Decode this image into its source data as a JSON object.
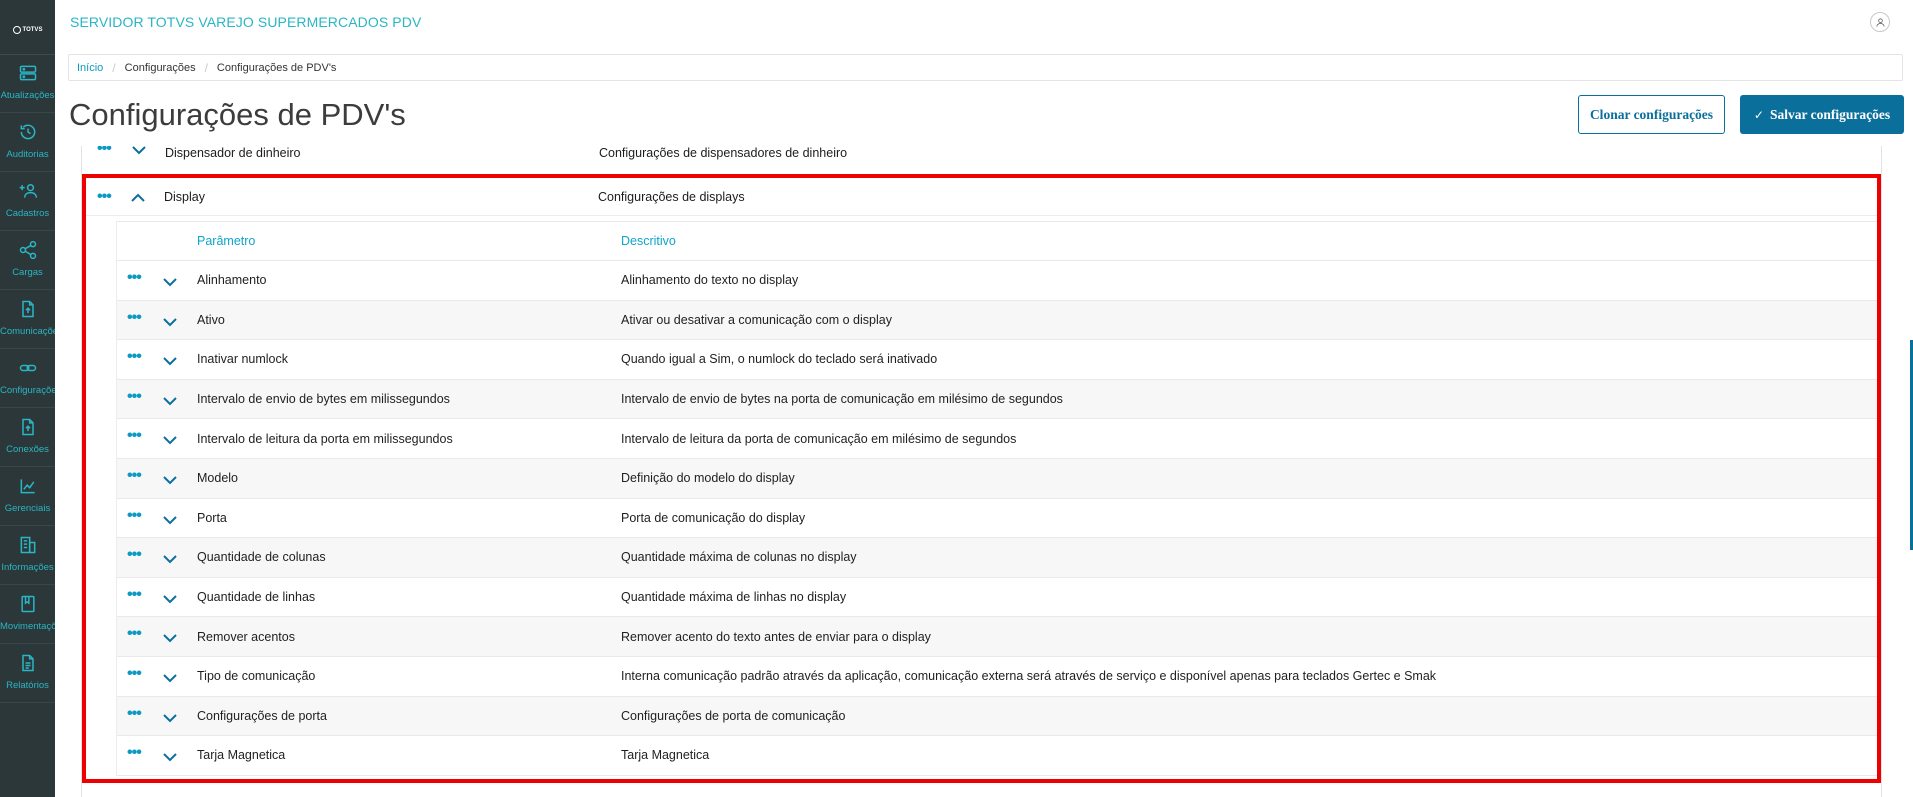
{
  "app": {
    "title": "SERVIDOR TOTVS VAREJO SUPERMERCADOS PDV",
    "logo_text": "TOTVS"
  },
  "sidebar": {
    "items": [
      {
        "label": "Atualizações",
        "icon": "server-icon"
      },
      {
        "label": "Auditorias",
        "icon": "history-icon"
      },
      {
        "label": "Cadastros",
        "icon": "add-user-icon"
      },
      {
        "label": "Cargas",
        "icon": "share-icon"
      },
      {
        "label": "Comunicações",
        "icon": "upload-file-icon"
      },
      {
        "label": "Configurações",
        "icon": "link-icon"
      },
      {
        "label": "Conexões",
        "icon": "upload-file-icon"
      },
      {
        "label": "Gerenciais",
        "icon": "chart-icon"
      },
      {
        "label": "Informações",
        "icon": "building-icon"
      },
      {
        "label": "Movimentações",
        "icon": "book-icon"
      },
      {
        "label": "Relatórios",
        "icon": "document-icon"
      }
    ]
  },
  "breadcrumb": [
    "Início",
    "Configurações",
    "Configurações de PDV's"
  ],
  "page": {
    "title": "Configurações de PDV's",
    "clone_button": "Clonar configurações",
    "save_button": "Salvar configurações"
  },
  "groups": {
    "previous": {
      "name": "Dispensador de dinheiro",
      "description": "Configurações de dispensadores de dinheiro"
    },
    "current": {
      "name": "Display",
      "description": "Configurações de displays"
    }
  },
  "table": {
    "headers": {
      "parameter": "Parâmetro",
      "description": "Descritivo"
    },
    "rows": [
      {
        "parameter": "Alinhamento",
        "description": "Alinhamento do texto no display"
      },
      {
        "parameter": "Ativo",
        "description": "Ativar ou desativar a comunicação com o display"
      },
      {
        "parameter": "Inativar numlock",
        "description": "Quando igual a Sim, o numlock do teclado será inativado"
      },
      {
        "parameter": "Intervalo de envio de bytes em milissegundos",
        "description": "Intervalo de envio de bytes na porta de comunicação em milésimo de segundos"
      },
      {
        "parameter": "Intervalo de leitura da porta em milissegundos",
        "description": "Intervalo de leitura da porta de comunicação em milésimo de segundos"
      },
      {
        "parameter": "Modelo",
        "description": "Definição do modelo do display"
      },
      {
        "parameter": "Porta",
        "description": "Porta de comunicação do display"
      },
      {
        "parameter": "Quantidade de colunas",
        "description": "Quantidade máxima de colunas no display"
      },
      {
        "parameter": "Quantidade de linhas",
        "description": "Quantidade máxima de linhas no display"
      },
      {
        "parameter": "Remover acentos",
        "description": "Remover acento do texto antes de enviar para o display"
      },
      {
        "parameter": "Tipo de comunicação",
        "description": "Interna comunicação padrão através da aplicação, comunicação externa será através de serviço e disponível apenas para teclados Gertec e Smak"
      },
      {
        "parameter": "Configurações de porta",
        "description": "Configurações de porta de comunicação"
      },
      {
        "parameter": "Tarja Magnetica",
        "description": "Tarja Magnetica"
      }
    ]
  },
  "colors": {
    "sidebar_bg": "#2c3739",
    "accent": "#29b6c5",
    "primary": "#0b6f9c",
    "highlight_border": "#ee0000"
  }
}
